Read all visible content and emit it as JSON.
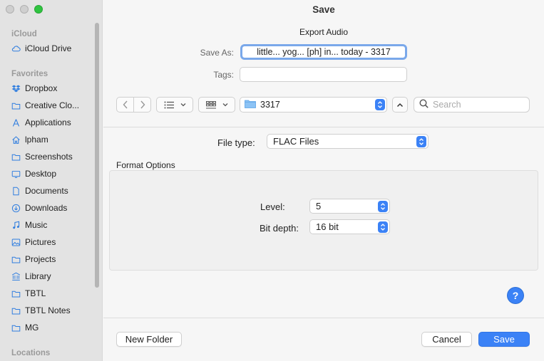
{
  "window": {
    "title": "Save"
  },
  "sidebar": {
    "icloud_heading": "iCloud",
    "icloud_items": [
      {
        "label": "iCloud Drive",
        "icon": "cloud-icon"
      }
    ],
    "favorites_heading": "Favorites",
    "favorites": [
      {
        "label": "Dropbox",
        "icon": "dropbox-icon"
      },
      {
        "label": "Creative Clo...",
        "icon": "folder-icon"
      },
      {
        "label": "Applications",
        "icon": "applications-icon"
      },
      {
        "label": "lpham",
        "icon": "home-icon"
      },
      {
        "label": "Screenshots",
        "icon": "folder-icon"
      },
      {
        "label": "Desktop",
        "icon": "desktop-icon"
      },
      {
        "label": "Documents",
        "icon": "document-icon"
      },
      {
        "label": "Downloads",
        "icon": "download-icon"
      },
      {
        "label": "Music",
        "icon": "music-icon"
      },
      {
        "label": "Pictures",
        "icon": "pictures-icon"
      },
      {
        "label": "Projects",
        "icon": "folder-icon"
      },
      {
        "label": "Library",
        "icon": "library-icon"
      },
      {
        "label": "TBTL",
        "icon": "folder-icon"
      },
      {
        "label": "TBTL Notes",
        "icon": "folder-icon"
      },
      {
        "label": "MG",
        "icon": "folder-icon"
      }
    ],
    "locations_heading": "Locations"
  },
  "header": {
    "export_title": "Export Audio"
  },
  "form": {
    "save_as_label": "Save As:",
    "save_as_value": "little... yog... [ph] in... today - 3317",
    "tags_label": "Tags:",
    "tags_value": ""
  },
  "toolbar": {
    "folder_name": "3317",
    "search_placeholder": "Search"
  },
  "options": {
    "file_type_label": "File type:",
    "file_type_value": "FLAC Files",
    "format_options_title": "Format Options",
    "level_label": "Level:",
    "level_value": "5",
    "bit_depth_label": "Bit depth:",
    "bit_depth_value": "16 bit"
  },
  "footer": {
    "help_label": "?",
    "new_folder_label": "New Folder",
    "cancel_label": "Cancel",
    "save_label": "Save"
  },
  "colors": {
    "accent": "#3b82f6",
    "sidebar_icon": "#2f7ddf"
  }
}
